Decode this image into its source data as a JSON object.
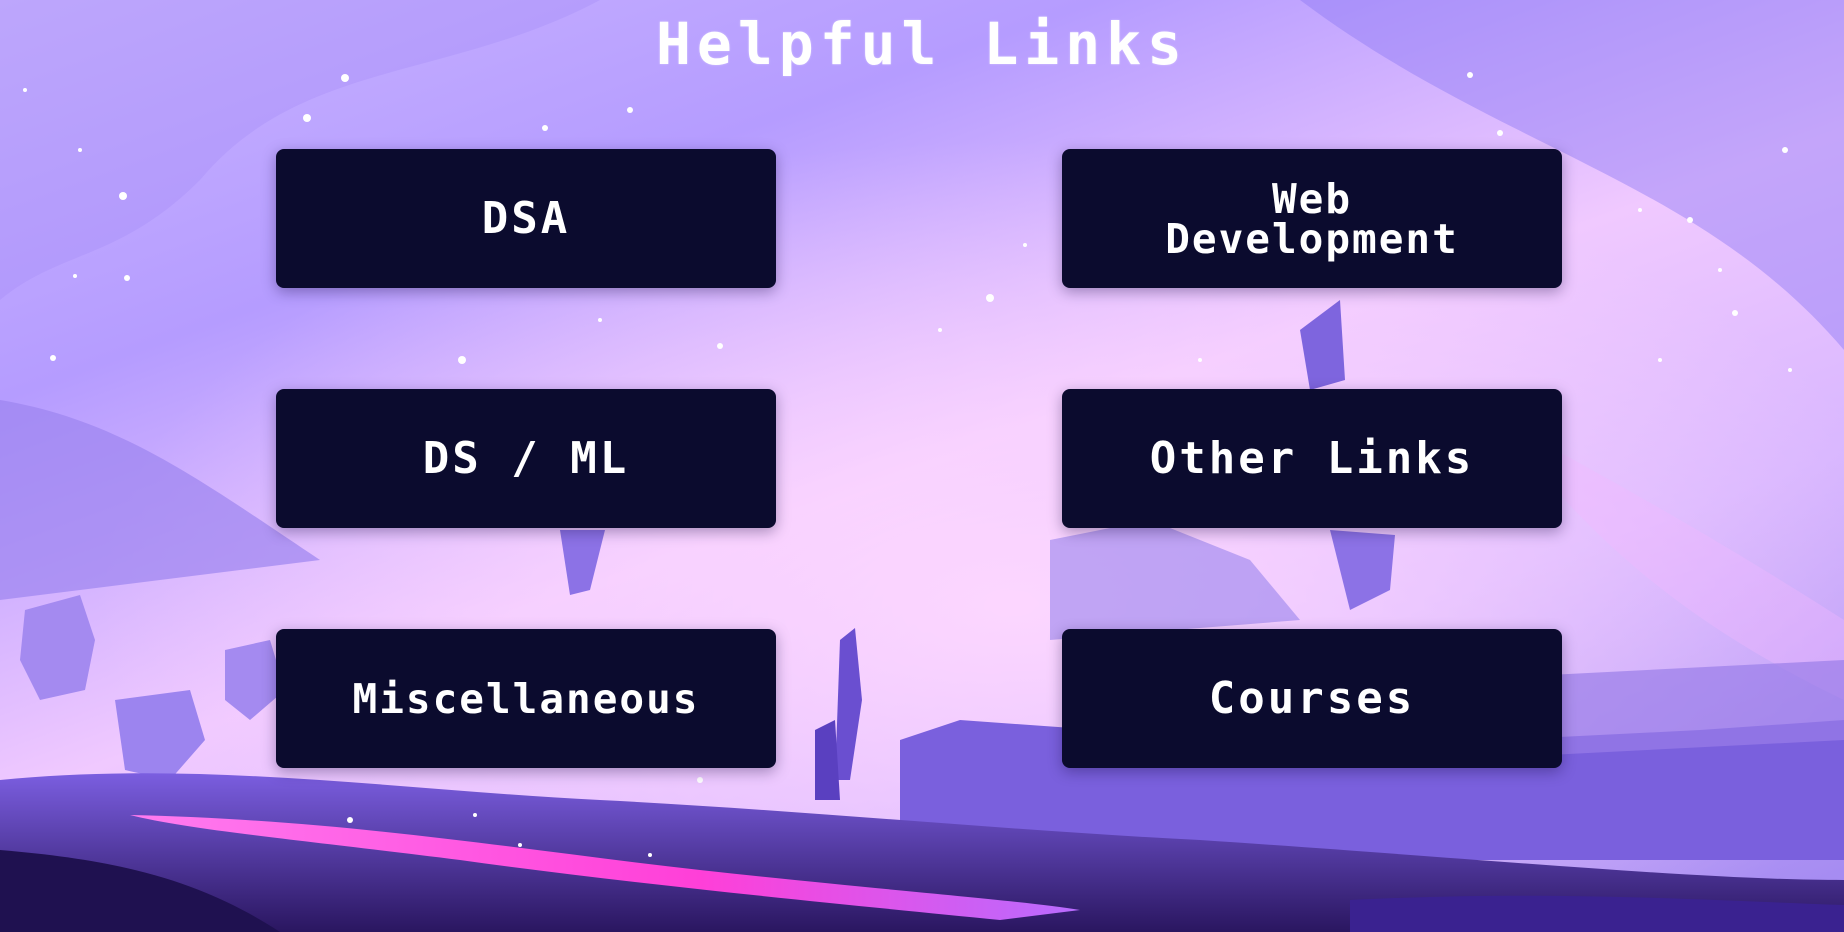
{
  "page": {
    "title": "Helpful Links"
  },
  "links": [
    {
      "id": "dsa",
      "label": "DSA"
    },
    {
      "id": "web",
      "label": "Web\nDevelopment"
    },
    {
      "id": "dsml",
      "label": "DS / ML"
    },
    {
      "id": "other",
      "label": "Other Links"
    },
    {
      "id": "misc",
      "label": "Miscellaneous"
    },
    {
      "id": "courses",
      "label": "Courses"
    }
  ],
  "colors": {
    "card_background": "#0b0b2e",
    "card_text": "#ffffff",
    "title_text": "#ffffff",
    "sky_light": "#f0c9ff",
    "sky_purple": "#b59cff",
    "terrain_dark": "#2a1660",
    "glow_magenta": "#ff5ee8"
  }
}
